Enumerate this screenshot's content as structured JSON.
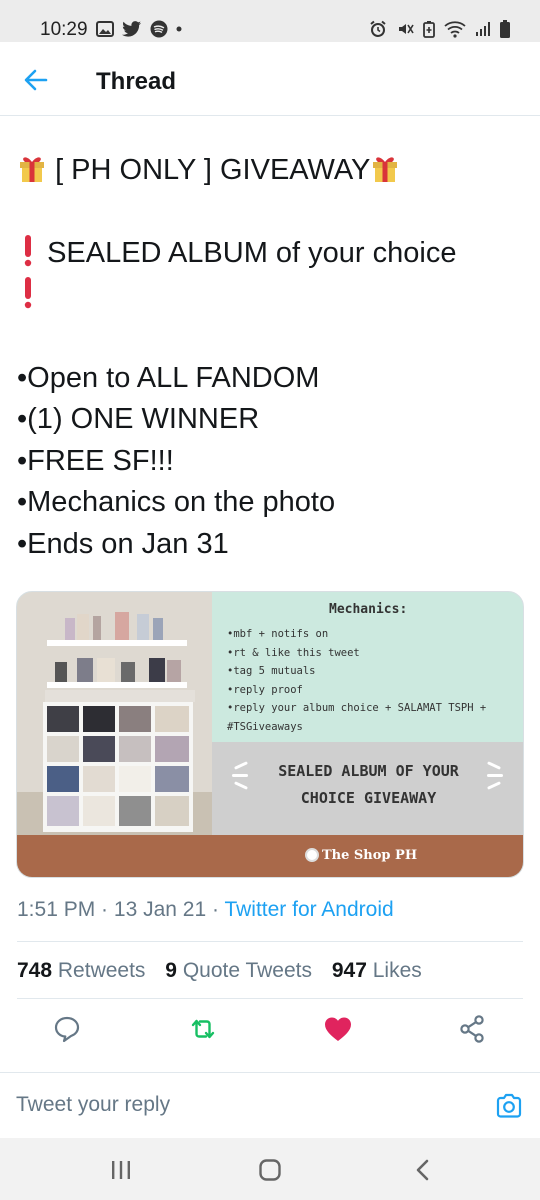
{
  "status_bar": {
    "time": "10:29",
    "left_icons": [
      "gallery-icon",
      "twitter-bird-icon",
      "spotify-icon",
      "dot-icon"
    ],
    "right_icons": [
      "alarm-icon",
      "mute-icon",
      "battery-saver-icon",
      "wifi-icon",
      "signal-icon",
      "battery-icon"
    ]
  },
  "header": {
    "back_icon": "arrow-left-icon",
    "title": "Thread"
  },
  "tweet": {
    "lines": [
      "[ PH ONLY ] GIVEAWAY",
      "",
      "SEALED ALBUM of your choice",
      "",
      "",
      "•Open to ALL FANDOM",
      "•(1) ONE WINNER",
      "•FREE SF!!!",
      "•Mechanics on the photo",
      "•Ends on Jan 31"
    ],
    "emoji": {
      "gift": "gift-icon",
      "exclamation": "red-exclamation-icon"
    }
  },
  "media": {
    "mechanics_title": "Mechanics:",
    "mechanics_items": [
      "•mbf + notifs on",
      "•rt & like this tweet",
      "•tag 5 mutuals",
      "•reply proof",
      "•reply your album choice + SALAMAT TSPH +",
      "#TSGiveaways"
    ],
    "banner_line1": "SEALED ALBUM OF YOUR",
    "banner_line2": "CHOICE GIVEAWAY",
    "shop_label": "The Shop PH",
    "colors": {
      "mint": "#cce9df",
      "gray_band": "#cfcfcf",
      "brown_band": "#a9694a"
    }
  },
  "meta": {
    "time": "1:51 PM",
    "sep1": " · ",
    "date": "13 Jan 21",
    "sep2": " · ",
    "source": "Twitter for Android"
  },
  "stats": {
    "retweets_count": "748",
    "retweets_label": "Retweets",
    "quotes_count": "9",
    "quotes_label": "Quote Tweets",
    "likes_count": "947",
    "likes_label": "Likes"
  },
  "actions": {
    "reply_icon": "reply-icon",
    "retweet_icon": "retweet-icon",
    "like_icon": "heart-icon",
    "share_icon": "share-icon",
    "colors": {
      "retweeted": "#17bf63",
      "liked": "#e0245e",
      "default": "#657786"
    }
  },
  "reply": {
    "placeholder": "Tweet your reply",
    "camera_icon": "camera-icon",
    "accent": "#1da1f2"
  },
  "nav": {
    "recents_icon": "recents-icon",
    "home_icon": "home-icon",
    "back_icon": "back-chevron-icon"
  }
}
